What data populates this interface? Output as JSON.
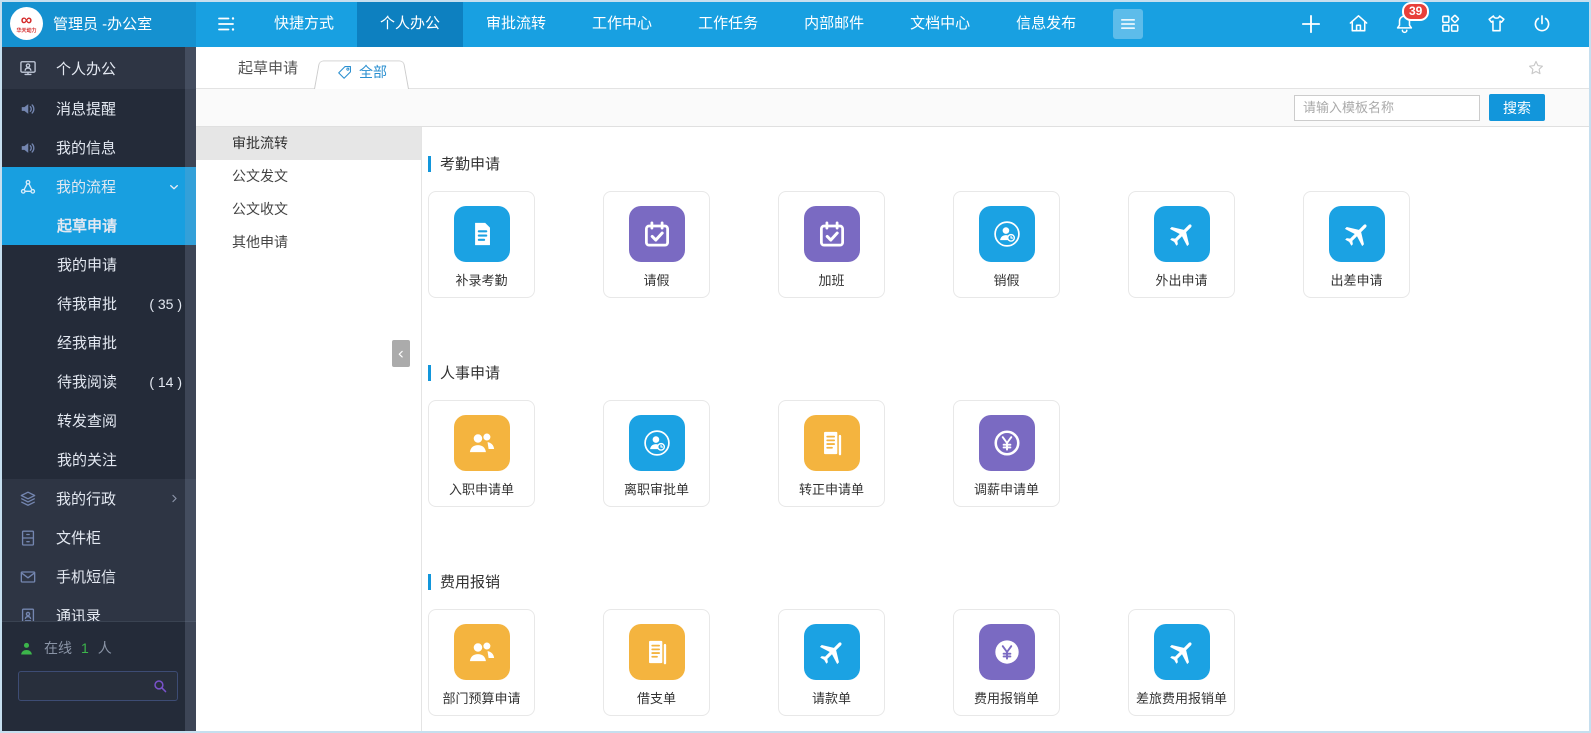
{
  "colors": {
    "topbar": "#18a0e1",
    "topbar_brand": "#1591d0",
    "topbar_active": "#0d80c0",
    "sidebar": "#2e3544",
    "sidebar_dark": "#242b39",
    "accent": "#189fe0",
    "badge_red": "#e8403a",
    "online_green": "#3cb54b",
    "blue": "#1ba2e3",
    "purple": "#7a6ac2",
    "yellow": "#f4b43f"
  },
  "topbar": {
    "brand": {
      "logo_symbol": "∞",
      "logo_text": "华天动力",
      "user_label": "管理员 -办公室"
    },
    "menu_toggle_icon": "menu-collapse-icon",
    "menu": [
      {
        "label": "快捷方式",
        "active": false
      },
      {
        "label": "个人办公",
        "active": true
      },
      {
        "label": "审批流转",
        "active": false
      },
      {
        "label": "工作中心",
        "active": false
      },
      {
        "label": "工作任务",
        "active": false
      },
      {
        "label": "内部邮件",
        "active": false
      },
      {
        "label": "文档中心",
        "active": false
      },
      {
        "label": "信息发布",
        "active": false
      }
    ],
    "more_menu_icon": "hamburger-icon",
    "actions": [
      {
        "name": "add",
        "icon": "plus-icon"
      },
      {
        "name": "home",
        "icon": "home-icon"
      },
      {
        "name": "notifications",
        "icon": "bell-icon",
        "badge": "39"
      },
      {
        "name": "apps",
        "icon": "apps-icon"
      },
      {
        "name": "theme",
        "icon": "shirt-icon"
      },
      {
        "name": "power",
        "icon": "power-icon"
      }
    ]
  },
  "sidebar": {
    "items": [
      {
        "label": "个人办公",
        "icon": "user-monitor-icon",
        "variant": "header"
      },
      {
        "label": "消息提醒",
        "icon": "speaker-icon",
        "variant": "dark"
      },
      {
        "label": "我的信息",
        "icon": "speaker-icon",
        "variant": "dark"
      },
      {
        "label": "我的流程",
        "icon": "flow-icon",
        "variant": "parent-active",
        "chevron": "down"
      },
      {
        "label": "起草申请",
        "sub": true,
        "active": true
      },
      {
        "label": "我的申请",
        "sub": true
      },
      {
        "label": "待我审批",
        "sub": true,
        "count": "( 35 )"
      },
      {
        "label": "经我审批",
        "sub": true
      },
      {
        "label": "待我阅读",
        "sub": true,
        "count": "( 14 )"
      },
      {
        "label": "转发查阅",
        "sub": true
      },
      {
        "label": "我的关注",
        "sub": true
      },
      {
        "label": "我的行政",
        "icon": "layers-icon",
        "variant": "light",
        "chevron": "right"
      },
      {
        "label": "文件柜",
        "icon": "cabinet-icon",
        "variant": "light"
      },
      {
        "label": "手机短信",
        "icon": "mail-icon",
        "variant": "light"
      },
      {
        "label": "通讯录",
        "icon": "contacts-icon",
        "variant": "light"
      }
    ],
    "online": {
      "icon": "online-user-icon",
      "prefix": "在线",
      "count": "1",
      "suffix": "人"
    },
    "search": {
      "icon": "search-icon",
      "value": ""
    }
  },
  "tabs": {
    "page_label": "起草申请",
    "active_tab": {
      "icon": "tag-icon",
      "label": "全部"
    },
    "favorite_icon": "star-icon"
  },
  "toolbar": {
    "search_placeholder": "请输入模板名称",
    "search_button": "搜索"
  },
  "subnav": {
    "items": [
      {
        "label": "审批流转",
        "active": true
      },
      {
        "label": "公文发文",
        "active": false
      },
      {
        "label": "公文收文",
        "active": false
      },
      {
        "label": "其他申请",
        "active": false
      }
    ],
    "collapse_icon": "chevron-left-icon"
  },
  "content": {
    "sections": [
      {
        "title": "考勤申请",
        "cards": [
          {
            "label": "补录考勤",
            "icon": "file-text-icon",
            "color": "blue"
          },
          {
            "label": "请假",
            "icon": "calendar-check-icon",
            "color": "purple"
          },
          {
            "label": "加班",
            "icon": "calendar-check-icon",
            "color": "purple"
          },
          {
            "label": "销假",
            "icon": "user-clock-icon",
            "color": "blue"
          },
          {
            "label": "外出申请",
            "icon": "plane-icon",
            "color": "blue"
          },
          {
            "label": "出差申请",
            "icon": "plane-icon",
            "color": "blue"
          }
        ]
      },
      {
        "title": "人事申请",
        "cards": [
          {
            "label": "入职申请单",
            "icon": "users-icon",
            "color": "yellow"
          },
          {
            "label": "离职审批单",
            "icon": "user-clock-icon",
            "color": "blue"
          },
          {
            "label": "转正申请单",
            "icon": "document-lines-icon",
            "color": "yellow"
          },
          {
            "label": "调薪申请单",
            "icon": "yen-ring-icon",
            "color": "purple"
          }
        ]
      },
      {
        "title": "费用报销",
        "cards": [
          {
            "label": "部门预算申请",
            "icon": "users-icon",
            "color": "yellow"
          },
          {
            "label": "借支单",
            "icon": "document-lines-icon",
            "color": "yellow"
          },
          {
            "label": "请款单",
            "icon": "plane-icon",
            "color": "blue"
          },
          {
            "label": "费用报销单",
            "icon": "yen-circle-icon",
            "color": "purple"
          },
          {
            "label": "差旅费用报销单",
            "icon": "plane-icon",
            "color": "blue"
          }
        ]
      }
    ]
  }
}
